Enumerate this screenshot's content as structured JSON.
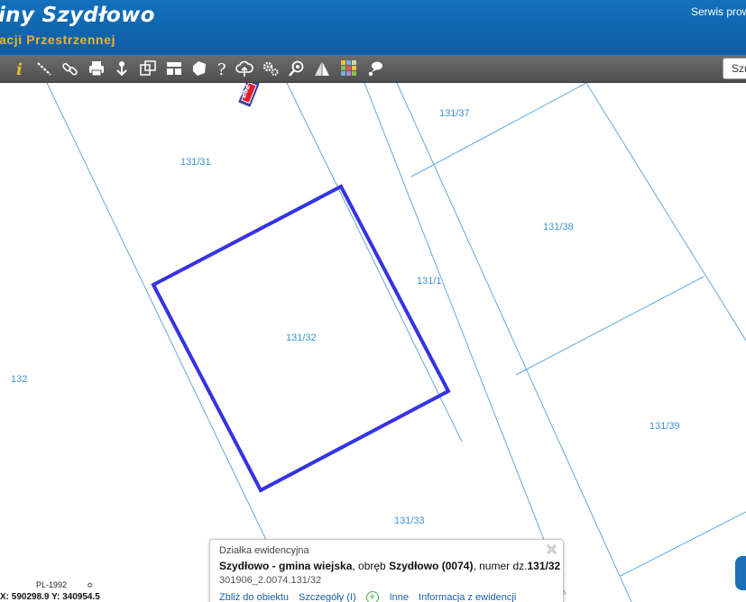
{
  "header": {
    "title": "iny Szydłowo",
    "subtitle": "acji Przestrzennej",
    "service_text": "Serwis prowa"
  },
  "toolbar": {
    "tools": [
      "info-icon",
      "measure-distance-icon",
      "link-icon",
      "print-icon",
      "download-icon",
      "layout-icon",
      "panels-icon",
      "area-icon",
      "help-icon",
      "cloud-upload-icon",
      "settings-icon",
      "zoom-search-icon",
      "sun-icon",
      "color-grid-icon",
      "comment-icon"
    ],
    "search_placeholder": "Szu"
  },
  "map": {
    "road_number": "252",
    "parcels": [
      "131/31",
      "131/37",
      "131/38",
      "131/1",
      "131/32",
      "132",
      "131/39",
      "131/33"
    ],
    "highlight_color": "#3333e6",
    "line_color": "#5fa9dd"
  },
  "popup": {
    "title": "Działka ewidencyjna",
    "main_bold_1": "Szydłowo - gmina wiejska",
    "main_text_1": ", obręb ",
    "main_bold_2": "Szydłowo (0074)",
    "main_text_2": ", numer dz.",
    "main_bold_3": "131/32",
    "identifier": "301906_2.0074.131/32",
    "links": {
      "zoom": "Zbliż do obiektu",
      "details": "Szczegóły (I)",
      "other": "Inne",
      "info": "Informacja z ewidencji"
    }
  },
  "status": {
    "crs": "PL-1992",
    "crs_caret": "≎",
    "coordinates": "X: 590298.9   Y: 340954.5"
  }
}
